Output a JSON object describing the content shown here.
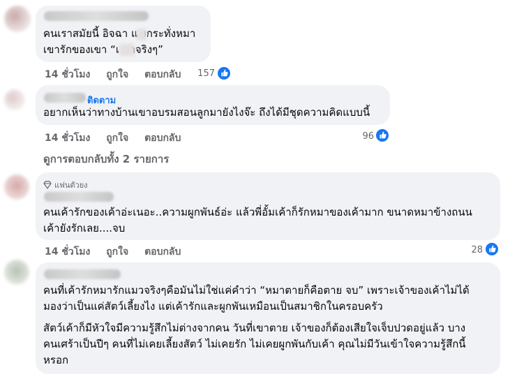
{
  "comments": [
    {
      "lines": [
        "คนเราสมัยนี้ อิจฉา แ  งกระทั่งหมา",
        "เขารักของเขา “เ   อกจริงๆ”"
      ],
      "time": "14 ชั่วโมง",
      "like_label": "ถูกใจ",
      "reply_label": "ตอบกลับ",
      "reactions": "157"
    },
    {
      "badge": "ติดตาม",
      "lines": [
        "อยากเห็นว่าทางบ้านเขาอบรมสอนลูกมายังไงจ๊ะ ถึงได้มีชุดความคิดแบบนี้"
      ],
      "time": "14 ชั่วโมง",
      "like_label": "ถูกใจ",
      "reply_label": "ตอบกลับ",
      "reactions": "96"
    },
    {
      "badge": "แฟนตัวยง",
      "lines": [
        "คนเค้ารักของเค้าอ่ะเนอะ..ความผูกพันธ์อ่ะ แล้วพี่อั้มเค้าก็รักหมาของเค้ามาก ขนาดหมาข้างถนน",
        "เค้ายังรักเลย....จบ"
      ],
      "time": "14 ชั่วโมง",
      "like_label": "ถูกใจ",
      "reply_label": "ตอบกลับ",
      "reactions": "28"
    },
    {
      "lines": [
        "คนที่เค้ารักหมารักแมวจริงๆคือมันไม่ใช่แค่คำว่า “หมาตายก็คือตาย จบ” เพราะเจ้าของเค้าไม่ได้",
        "มองว่าเป็นแค่สัตว์เลี้ยงไง แต่เค้ารักและผูกพันเหมือนเป็นสมาชิกในครอบครัว",
        "สัตว์เค้าก็มีหัวใจมีความรู้สึกไม่ต่างจากคน วันที่เขาตาย เจ้าของก็ต้องเสียใจเจ็บปวดอยู่แล้ว บาง",
        "คนเศร้าเป็นปีๆ คนที่ไม่เคยเลี้ยงสัตว์ ไม่เคยรัก ไม่เคยผูกพันกับเค้า คุณไม่มีวันเข้าใจความรู้สึกนี้",
        "หรอก"
      ]
    }
  ],
  "view_all_replies": "ดูการตอบกลับทั้ง 2 รายการ",
  "colors": {
    "bubble": "#f0f2f5",
    "accent": "#1877f2",
    "meta": "#65676b"
  }
}
